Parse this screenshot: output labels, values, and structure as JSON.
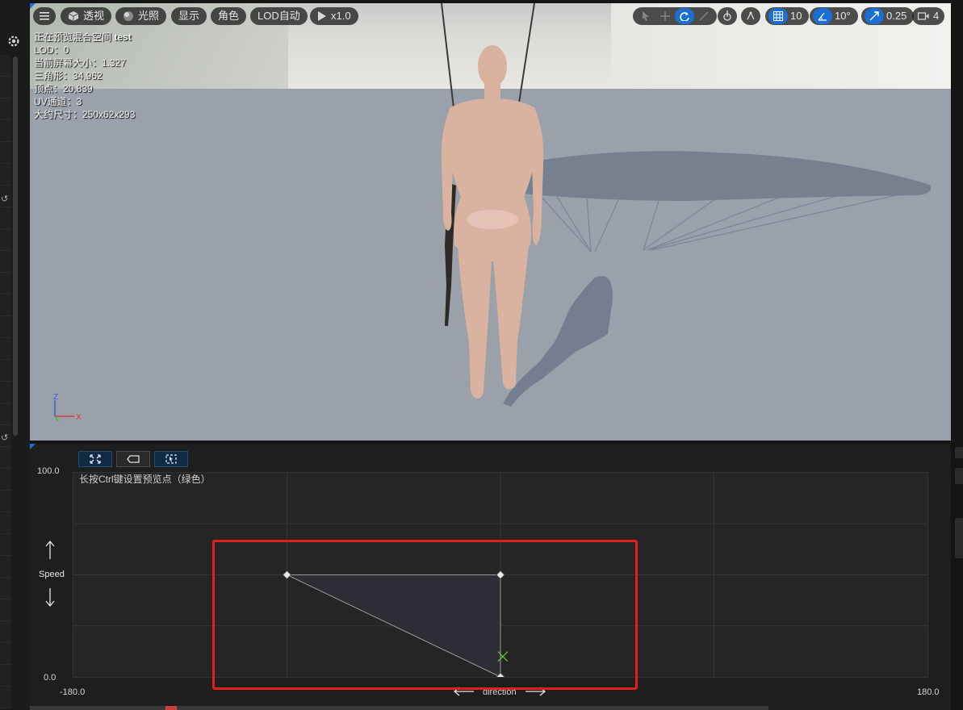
{
  "viewport": {
    "toolbar": {
      "menu_icon": "hamburger-icon",
      "view_mode": "透视",
      "lighting": "光照",
      "show": "显示",
      "character": "角色",
      "lod": "LOD自动",
      "playback": "x1.0",
      "grid_snap": "10",
      "rotation_snap": "10°",
      "scale_snap": "0.25",
      "camera_speed": "4"
    },
    "stats": {
      "line1_prefix": "正在预览混合空间",
      "asset_name": "test",
      "lod": "LOD：0",
      "screen_size": "当前屏幕大小：1.327",
      "triangles": "三角形：34,962",
      "vertices": "顶点：20,839",
      "uv_channels": "UV通道：3",
      "approx_size": "大约尺寸：250x62x293"
    },
    "axis_gizmo": {
      "z": "Z",
      "x": "X"
    }
  },
  "blendspace": {
    "hint": "长按Ctrl键设置预览点（绿色）",
    "y_axis": {
      "label": "Speed",
      "max": "100.0",
      "min": "0.0"
    },
    "x_axis": {
      "label": "direction",
      "min": "-180.0",
      "max": "180.0"
    },
    "samples": [
      {
        "direction": -90,
        "speed": 50
      },
      {
        "direction": 0,
        "speed": 50
      },
      {
        "direction": 0,
        "speed": 0
      }
    ],
    "preview_point": {
      "direction": 1,
      "speed": 10
    },
    "highlight_color": "#e21f1f"
  }
}
